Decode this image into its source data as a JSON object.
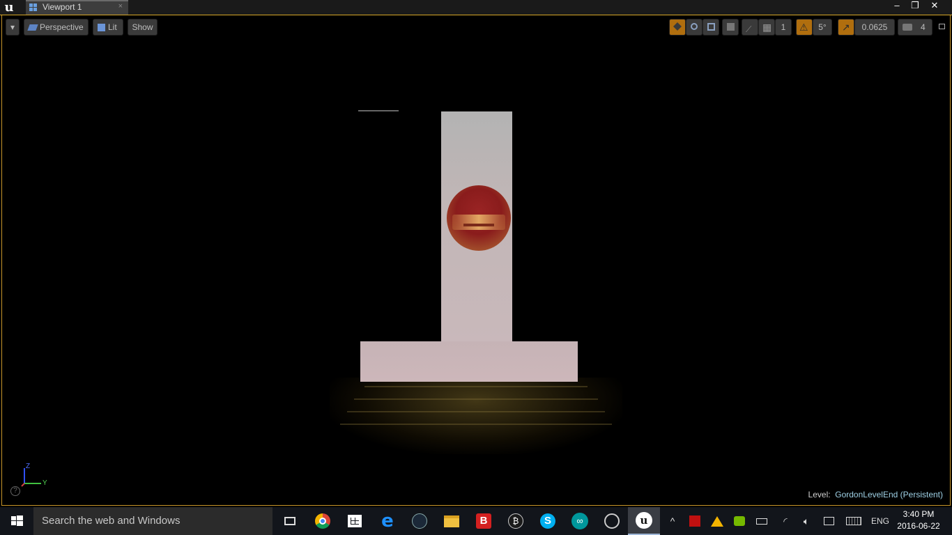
{
  "window": {
    "tab_label": "Viewport 1",
    "tab_close": "×",
    "minimize": "–",
    "restore": "❐",
    "close": "✕"
  },
  "viewport_toolbar": {
    "perspective_label": "Perspective",
    "lit_label": "Lit",
    "show_label": "Show",
    "grid_value": "1",
    "angle_value": "5°",
    "scale_value": "0.0625",
    "camera_speed": "4"
  },
  "gizmo": {
    "z_label": "Z",
    "y_label": "Y"
  },
  "level": {
    "prefix": "Level:",
    "name": "GordonLevelEnd (Persistent)"
  },
  "help_icon": "?",
  "taskbar": {
    "search_placeholder": "Search the web and Windows",
    "language": "ENG",
    "time": "3:40 PM",
    "date": "2016-06-22",
    "apps": [
      "task-view",
      "chrome",
      "store",
      "edge",
      "steam",
      "file-explorer",
      "bandicam",
      "bitcoin-app",
      "skype",
      "arduino",
      "obs",
      "unreal-engine"
    ]
  },
  "colors": {
    "accent": "#c8962a",
    "level_name": "#9fd1e6"
  }
}
